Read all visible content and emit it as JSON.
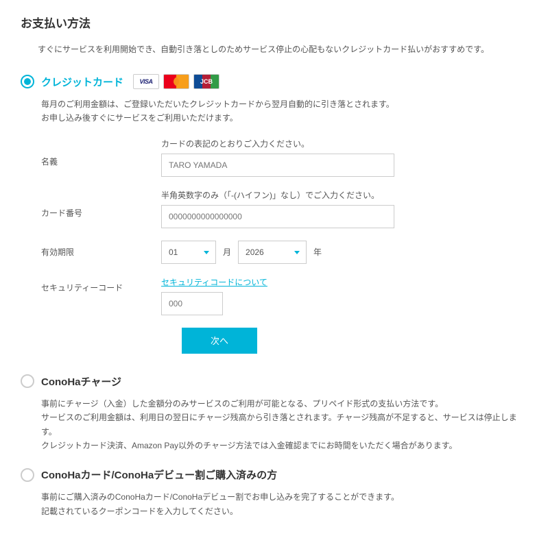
{
  "page": {
    "title": "お支払い方法",
    "intro": "すぐにサービスを利用開始でき、自動引き落としのためサービス停止の心配もないクレジットカード払いがおすすめです。"
  },
  "options": {
    "credit": {
      "title": "クレジットカード",
      "desc1": "毎月のご利用金額は、ご登録いただいたクレジットカードから翌月自動的に引き落とされます。",
      "desc2": "お申し込み後すぐにサービスをご利用いただけます。",
      "logos": {
        "visa": "VISA",
        "jcb": "JCB"
      }
    },
    "charge": {
      "title": "ConoHaチャージ",
      "desc1": "事前にチャージ（入金）した金額分のみサービスのご利用が可能となる、プリペイド形式の支払い方法です。",
      "desc2": "サービスのご利用金額は、利用日の翌日にチャージ残高から引き落とされます。チャージ残高が不足すると、サービスは停止します。",
      "desc3": "クレジットカード決済、Amazon Pay以外のチャージ方法では入金確認までにお時間をいただく場合があります。"
    },
    "card": {
      "title": "ConoHaカード/ConoHaデビュー割ご購入済みの方",
      "desc1": "事前にご購入済みのConoHaカード/ConoHaデビュー割でお申し込みを完了することができます。",
      "desc2": "記載されているクーポンコードを入力してください。"
    }
  },
  "form": {
    "name": {
      "label": "名義",
      "hint": "カードの表記のとおりご入力ください。",
      "placeholder": "TARO YAMADA"
    },
    "number": {
      "label": "カード番号",
      "hint": "半角英数字のみ（「-(ハイフン)」なし）でご入力ください。",
      "placeholder": "0000000000000000"
    },
    "expiry": {
      "label": "有効期限",
      "month": "01",
      "month_suffix": "月",
      "year": "2026",
      "year_suffix": "年"
    },
    "cvv": {
      "label": "セキュリティーコード",
      "link": "セキュリティコードについて",
      "placeholder": "000"
    },
    "submit": "次へ"
  }
}
